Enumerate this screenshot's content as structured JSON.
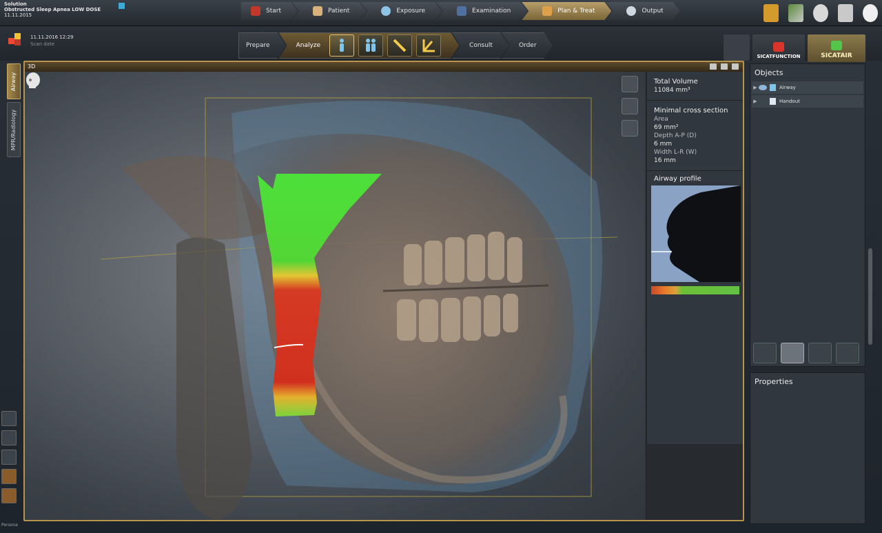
{
  "case": {
    "line1": "Solution",
    "line2": "Obstructed Sleep Apnea LOW DOSE",
    "line3": "11.11.2015"
  },
  "workflow": [
    {
      "label": "Start",
      "icon": "start-icon",
      "color": "#c0392b"
    },
    {
      "label": "Patient",
      "icon": "patient-icon",
      "color": "#d8b27a"
    },
    {
      "label": "Exposure",
      "icon": "exposure-icon",
      "color": "#8fc3e6"
    },
    {
      "label": "Examination",
      "icon": "examination-icon",
      "color": "#4f6fa0"
    },
    {
      "label": "Plan & Treat",
      "icon": "plan-treat-icon",
      "color": "#e0a04a",
      "active": true
    },
    {
      "label": "Output",
      "icon": "output-icon",
      "color": "#cfd8e0"
    }
  ],
  "scan": {
    "date": "11.11.2016 12:29",
    "label": "Scan date"
  },
  "steps": [
    {
      "label": "Prepare"
    },
    {
      "label": "Analyze",
      "active": true
    },
    {
      "label": "Consult"
    },
    {
      "label": "Order"
    }
  ],
  "modules": {
    "function_label": "SICATFUNCTION",
    "air_label": "SICATAIR"
  },
  "left_tabs": {
    "airway": "Airway",
    "mpr": "MPR/Radiology"
  },
  "viewport": {
    "title": "3D"
  },
  "measurements": {
    "total_volume_title": "Total Volume",
    "total_volume_value": "11084 mm³",
    "min_cross_title": "Minimal cross section",
    "area_label": "Area",
    "area_value": "69 mm²",
    "depth_label": "Depth A-P (D)",
    "depth_value": "6 mm",
    "width_label": "Width L-R (W)",
    "width_value": "16 mm",
    "profile_title": "Airway profile"
  },
  "objects": {
    "title": "Objects",
    "items": [
      {
        "label": "Airway"
      },
      {
        "label": "Handout"
      }
    ]
  },
  "properties": {
    "title": "Properties"
  },
  "footer": {
    "persona": "Persona"
  }
}
